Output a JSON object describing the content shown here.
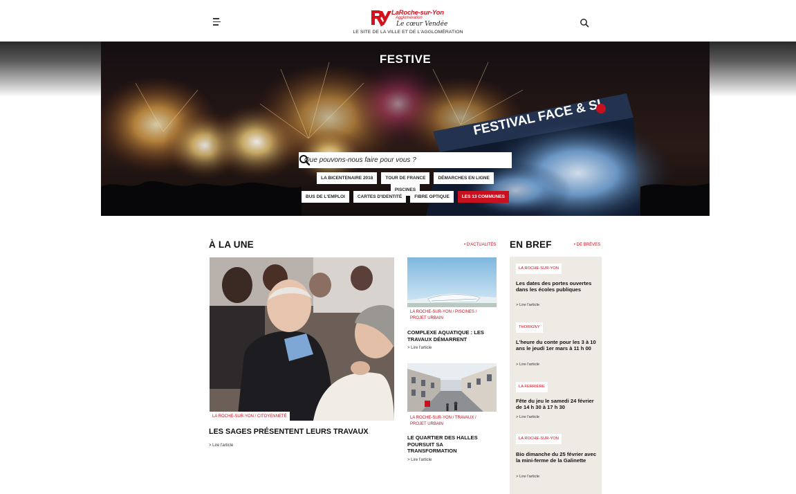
{
  "header": {
    "logo_name": "LaRoche-sur-Yon",
    "logo_sub": "Agglomération",
    "logo_script": "Le cœur Vendée",
    "tagline": "LE SITE DE LA VILLE ET DE L'AGGLOMÉRATION"
  },
  "hero": {
    "title": "FESTIVE",
    "stage_banner": "FESTIVAL FACE & SI",
    "search_placeholder": "Que pouvons-nous faire pour vous ?",
    "quick_links_row1": [
      "LA BICENTENAIRE 2018",
      "TOUR DE FRANCE",
      "DÉMARCHES EN LIGNE",
      "PISCINES"
    ],
    "quick_links_row2": [
      "BUS DE L'EMPLOI",
      "CARTES D'IDENTITÉ",
      "FIBRE OPTIQUE",
      "LES 13 COMMUNES"
    ]
  },
  "a_la_une": {
    "title": "À LA UNE",
    "more_link": "• D'ACTUALITÉS",
    "main": {
      "tag": "LA ROCHE-SUR-YON / CITOYENNETÉ",
      "title": "LES SAGES PRÉSENTENT LEURS TRAVAUX",
      "link": "> Lire l'article"
    },
    "cards": [
      {
        "tag_line1": "LA ROCHE-SUR-YON / PISCINES /",
        "tag_line2": "PROJET URBAIN",
        "title_line1": "COMPLEXE AQUATIQUE : LES",
        "title_line2": "TRAVAUX DÉMARRENT",
        "link": "> Lire l'article"
      },
      {
        "tag_line1": "LA ROCHE-SUR-YON / TRAVAUX /",
        "tag_line2": "PROJET URBAIN",
        "title_line1": "LE QUARTIER DES HALLES",
        "title_line2": "POURSUIT SA",
        "title_line3": "TRANSFORMATION",
        "link": "> Lire l'article"
      }
    ]
  },
  "en_bref": {
    "title": "EN BREF",
    "more_link": "• DE BRÈVES",
    "items": [
      {
        "tag": "LA ROCHE-SUR-YON",
        "title": "Les dates des portes ouvertes dans les écoles publiques",
        "link": "> Lire l'article"
      },
      {
        "tag": "THORIGNY",
        "title": "L'heure du conte pour les 3 à 10 ans le jeudi 1er mars à 11 h 00",
        "link": "> Lire l'article"
      },
      {
        "tag": "LA FERRIÈRE",
        "title": "Fête du jeu le samedi 24 février de 14 h 30 à 17 h 30",
        "link": "> Lire l'article"
      },
      {
        "tag": "LA ROCHE-SUR-YON",
        "title": "Bio dimanche du 25 février avec la mini-ferme de la Galinette",
        "link": "> Lire l'article"
      }
    ]
  },
  "colors": {
    "accent": "#c8101e",
    "bref_bg": "#eeebe4"
  }
}
